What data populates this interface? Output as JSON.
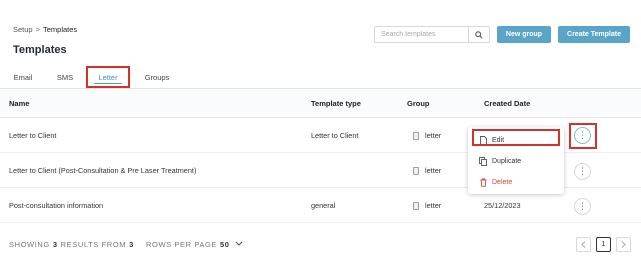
{
  "breadcrumb": {
    "parent": "Setup",
    "separator": ">",
    "current": "Templates"
  },
  "page_title": "Templates",
  "search": {
    "placeholder": "Search templates",
    "value": ""
  },
  "buttons": {
    "new_group": "New group",
    "create_template": "Create Template"
  },
  "tabs": [
    {
      "label": "Email",
      "active": false
    },
    {
      "label": "SMS",
      "active": false
    },
    {
      "label": "Letter",
      "active": true
    },
    {
      "label": "Groups",
      "active": false
    }
  ],
  "table": {
    "headers": {
      "name": "Name",
      "type": "Template type",
      "group": "Group",
      "created": "Created Date"
    },
    "rows": [
      {
        "name": "Letter to Client",
        "type": "Letter to Client",
        "group": "letter",
        "created": ""
      },
      {
        "name": "Letter to Client (Post-Consultation & Pre Laser Treatment)",
        "type": "",
        "group": "letter",
        "created": ""
      },
      {
        "name": "Post-consultation information",
        "type": "general",
        "group": "letter",
        "created": "25/12/2023"
      }
    ]
  },
  "context_menu": {
    "edit": "Edit",
    "duplicate": "Duplicate",
    "delete": "Delete"
  },
  "footer": {
    "showing_label": "SHOWING",
    "shown_count": "3",
    "results_label": "RESULTS FROM",
    "total": "3",
    "rows_label": "ROWS PER PAGE",
    "rows_value": "50",
    "current_page": "1"
  },
  "colors": {
    "accent": "#5aa4c8",
    "highlight": "#d1322c",
    "danger": "#d9433a"
  },
  "icons": [
    "search-icon",
    "file-icon",
    "more-vertical-icon",
    "edit-icon",
    "duplicate-icon",
    "trash-icon",
    "chevron-down-icon",
    "chevron-left-icon",
    "chevron-right-icon"
  ]
}
